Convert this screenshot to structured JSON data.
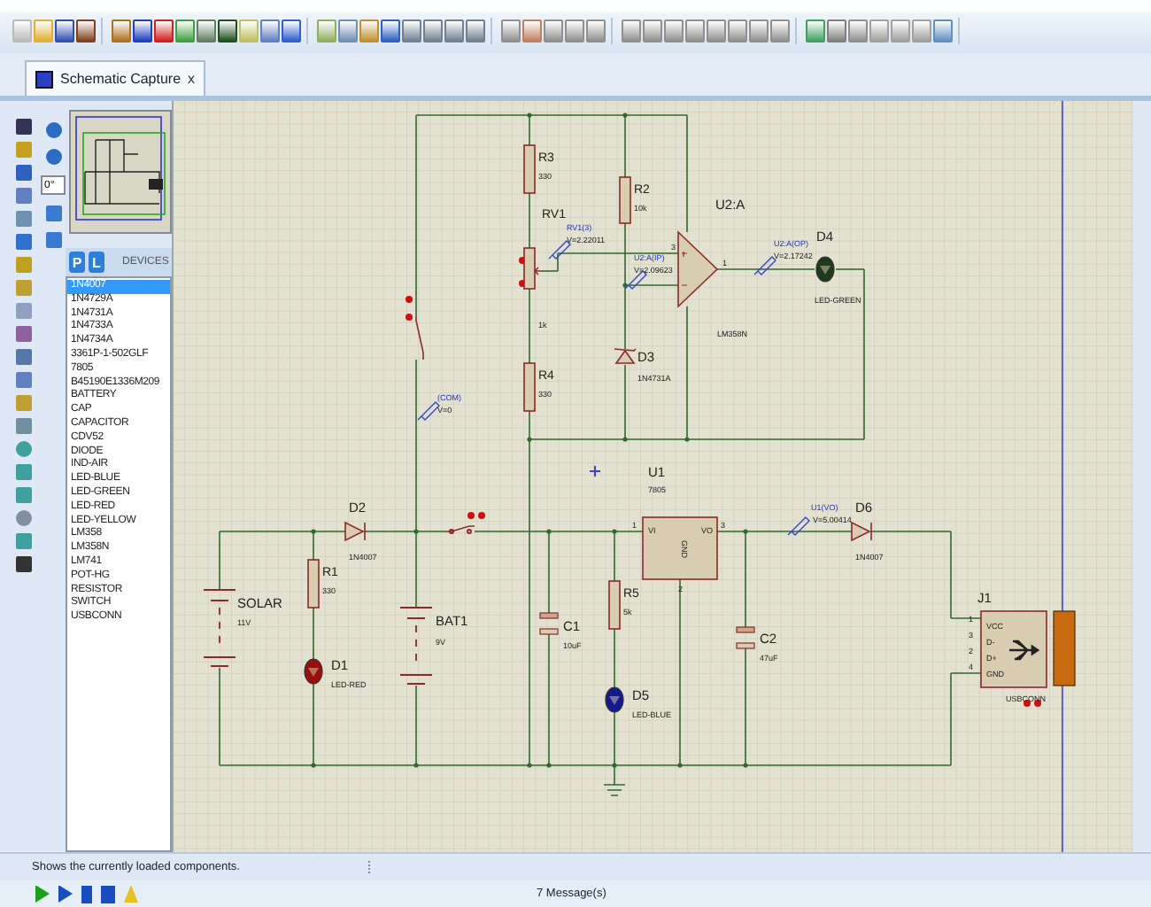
{
  "tab": {
    "label": "Schematic Capture",
    "close": "x"
  },
  "rotation_field": {
    "value": "0°"
  },
  "picker": {
    "modes": [
      {
        "label": "P",
        "selected": true
      },
      {
        "label": "L",
        "selected": true
      }
    ],
    "title": "DEVICES"
  },
  "devices": [
    {
      "name": "1N4007",
      "selected": true
    },
    {
      "name": "1N4729A",
      "selected": false
    },
    {
      "name": "1N4731A",
      "selected": false
    },
    {
      "name": "1N4733A",
      "selected": false
    },
    {
      "name": "1N4734A",
      "selected": false
    },
    {
      "name": "3361P-1-502GLF",
      "selected": false
    },
    {
      "name": "7805",
      "selected": false
    },
    {
      "name": "B45190E1336M209",
      "selected": false
    },
    {
      "name": "BATTERY",
      "selected": false
    },
    {
      "name": "CAP",
      "selected": false
    },
    {
      "name": "CAPACITOR",
      "selected": false
    },
    {
      "name": "CDV52",
      "selected": false
    },
    {
      "name": "DIODE",
      "selected": false
    },
    {
      "name": "IND-AIR",
      "selected": false
    },
    {
      "name": "LED-BLUE",
      "selected": false
    },
    {
      "name": "LED-GREEN",
      "selected": false
    },
    {
      "name": "LED-RED",
      "selected": false
    },
    {
      "name": "LED-YELLOW",
      "selected": false
    },
    {
      "name": "LM358",
      "selected": false
    },
    {
      "name": "LM358N",
      "selected": false
    },
    {
      "name": "LM741",
      "selected": false
    },
    {
      "name": "POT-HG",
      "selected": false
    },
    {
      "name": "RESISTOR",
      "selected": false
    },
    {
      "name": "SWITCH",
      "selected": false
    },
    {
      "name": "USBCONN",
      "selected": false
    }
  ],
  "parts": [
    {
      "kind": "resistor",
      "ref": "R3",
      "value": "330"
    },
    {
      "kind": "resistor",
      "ref": "R2",
      "value": "10k"
    },
    {
      "kind": "pot",
      "ref": "RV1",
      "value": "1k"
    },
    {
      "kind": "opamp",
      "ref": "U2:A",
      "value": "LM358N",
      "pin_numbers": [
        "3",
        "1"
      ]
    },
    {
      "kind": "led",
      "ref": "D4",
      "value": "LED-GREEN",
      "color": "#1f3a1f"
    },
    {
      "kind": "zener",
      "ref": "D3",
      "value": "1N4731A"
    },
    {
      "kind": "resistor",
      "ref": "R4",
      "value": "330"
    },
    {
      "kind": "regulator",
      "ref": "U1",
      "value": "7805",
      "pins": [
        "VI",
        "VO",
        "GND"
      ],
      "pin_numbers": [
        "1",
        "3",
        "2"
      ]
    },
    {
      "kind": "diode",
      "ref": "D2",
      "value": "1N4007"
    },
    {
      "kind": "diode",
      "ref": "D6",
      "value": "1N4007"
    },
    {
      "kind": "resistor",
      "ref": "R1",
      "value": "330"
    },
    {
      "kind": "resistor",
      "ref": "R5",
      "value": "5k"
    },
    {
      "kind": "usb",
      "ref": "J1",
      "value": "USBCONN",
      "pins": [
        "VCC",
        "D-",
        "D+",
        "GND"
      ],
      "pin_numbers": [
        "1",
        "3",
        "2",
        "4"
      ]
    },
    {
      "kind": "battery",
      "ref": "SOLAR",
      "value": "11V"
    },
    {
      "kind": "battery",
      "ref": "BAT1",
      "value": "9V"
    },
    {
      "kind": "capacitor",
      "ref": "C1",
      "value": "10uF"
    },
    {
      "kind": "capacitor",
      "ref": "C2",
      "value": "47uF"
    },
    {
      "kind": "led",
      "ref": "D1",
      "value": "LED-RED",
      "color": "#9b0e0e"
    },
    {
      "kind": "led",
      "ref": "D5",
      "value": "LED-BLUE",
      "color": "#141a8c"
    }
  ],
  "probes": [
    {
      "name": "RV1(3)",
      "reading": "V=2.22011"
    },
    {
      "name": "U2:A(IP)",
      "reading": "V=2.09623"
    },
    {
      "name": "U2:A(OP)",
      "reading": "V=2.17242"
    },
    {
      "name": "(COM)",
      "reading": "V=0"
    },
    {
      "name": "U1(VO)",
      "reading": "V=5.00414"
    }
  ],
  "status_bar": {
    "text": "Shows the currently loaded components."
  },
  "simulation_bar": {
    "messages": "7 Message(s)"
  }
}
